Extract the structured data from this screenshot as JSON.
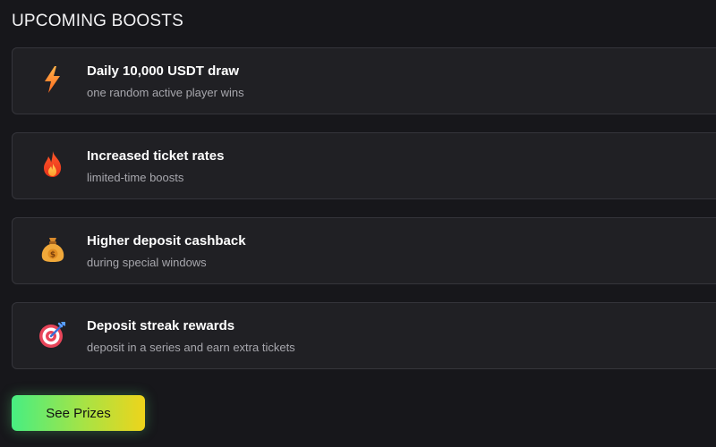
{
  "section": {
    "title": "UPCOMING BOOSTS"
  },
  "boosts": [
    {
      "icon": "lightning-icon",
      "title": "Daily 10,000 USDT draw",
      "subtitle": "one random active player wins"
    },
    {
      "icon": "fire-icon",
      "title": "Increased ticket rates",
      "subtitle": "limited-time boosts"
    },
    {
      "icon": "money-bag-icon",
      "title": "Higher deposit cashback",
      "subtitle": "during special windows"
    },
    {
      "icon": "target-icon",
      "title": "Deposit streak rewards",
      "subtitle": "deposit in a series and earn extra tickets"
    }
  ],
  "cta": {
    "label": "See Prizes"
  },
  "colors": {
    "background": "#17171b",
    "card": "#202024",
    "card_border": "#35353b",
    "cta_gradient_start": "#47ee82",
    "cta_gradient_end": "#eed41b"
  }
}
